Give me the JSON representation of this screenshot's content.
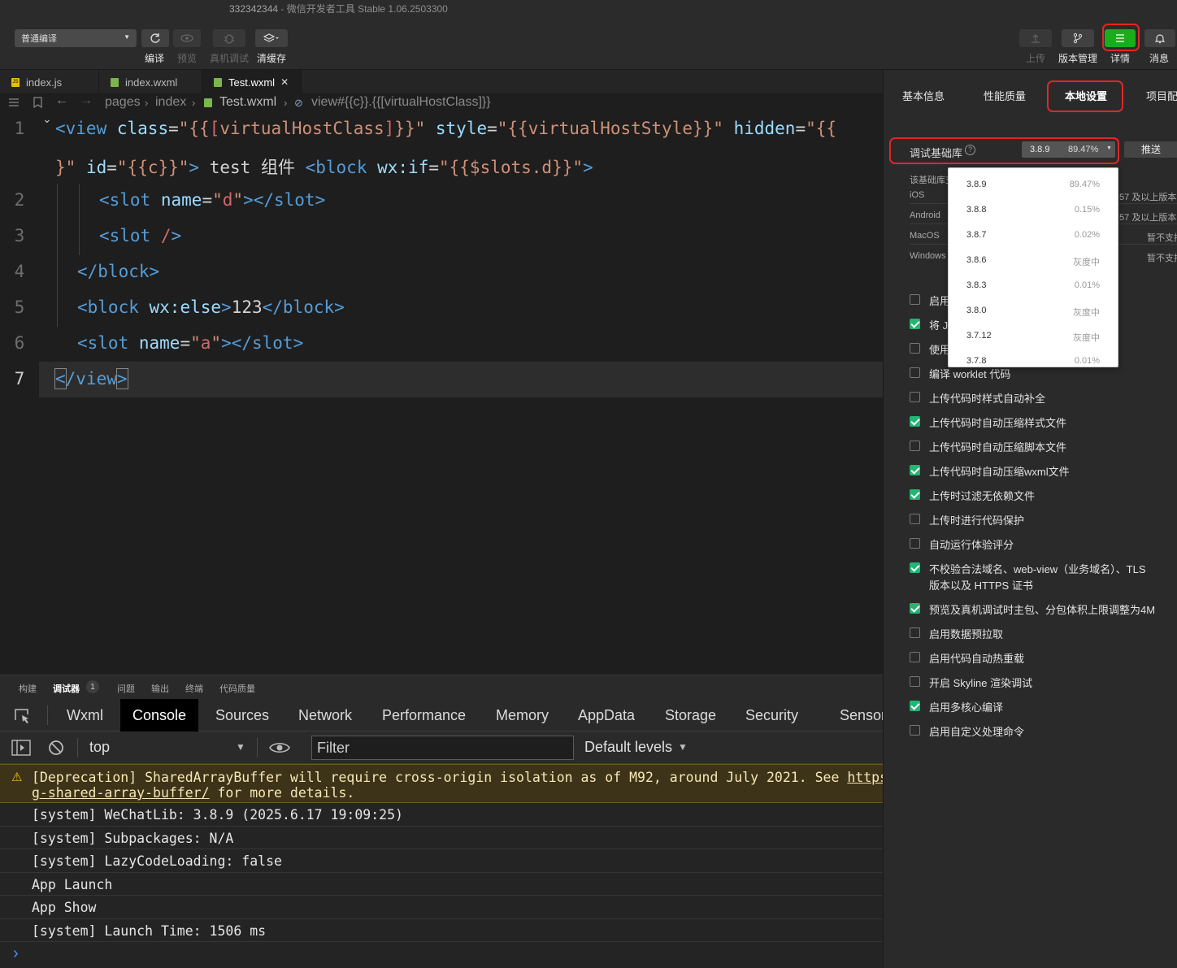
{
  "window": {
    "project_id": "332342344",
    "title_suffix": " - 微信开发者工具 Stable 1.06.2503300"
  },
  "toolbar": {
    "mode_select": "普通编译",
    "left_buttons": [
      {
        "label": "编译",
        "enabled": true
      },
      {
        "label": "预览",
        "enabled": false
      },
      {
        "label": "真机调试",
        "enabled": false
      },
      {
        "label": "清缓存",
        "enabled": true
      }
    ],
    "right_buttons": [
      {
        "label": "上传",
        "enabled": false
      },
      {
        "label": "版本管理",
        "enabled": true
      },
      {
        "label": "详情",
        "enabled": true,
        "active": true
      },
      {
        "label": "消息",
        "enabled": true
      }
    ],
    "accent_color": "#1aad19"
  },
  "file_tabs": [
    {
      "name": "index.js",
      "icon": "js-file-icon"
    },
    {
      "name": "index.wxml",
      "icon": "wxml-file-icon"
    },
    {
      "name": "Test.wxml",
      "icon": "wxml-file-icon",
      "active": true,
      "close": "✕"
    }
  ],
  "breadcrumb": {
    "path": [
      "pages",
      "index",
      "Test.wxml",
      "view#{{c}}.{{[virtualHostClass]}}"
    ]
  },
  "editor": {
    "line_numbers": [
      "1",
      "2",
      "3",
      "4",
      "5",
      "6",
      "7"
    ],
    "current_line": "7"
  },
  "bottom_panel": {
    "tabs": [
      "构建",
      "调试器",
      "问题",
      "输出",
      "终端",
      "代码质量"
    ],
    "active_tab": "调试器",
    "badge": "1"
  },
  "devtools": {
    "tabs": [
      "Wxml",
      "Console",
      "Sources",
      "Network",
      "Performance",
      "Memory",
      "AppData",
      "Storage",
      "Security",
      "Sensor"
    ],
    "active_tab": "Console",
    "context": "top",
    "filter_placeholder": "Filter",
    "levels": "Default levels"
  },
  "console": {
    "warning_line1": "[Deprecation] SharedArrayBuffer will require cross-origin isolation as of M92, around July 2021. See ",
    "warning_link": "https",
    "warning_line2_link": "g-shared-array-buffer/",
    "warning_line2_rest": " for more details.",
    "lines": [
      "[system] WeChatLib: 3.8.9 (2025.6.17 19:09:25)",
      "[system] Subpackages: N/A",
      "[system] LazyCodeLoading: false",
      "App Launch",
      "App Show",
      "[system] Launch Time: 1506 ms"
    ],
    "prompt": "›"
  },
  "right_panel": {
    "tabs": [
      "基本信息",
      "性能质量",
      "本地设置",
      "项目配"
    ],
    "active_tab": "本地设置",
    "base_lib_label": "调试基础库",
    "base_lib_version": "3.8.9",
    "base_lib_percent": "89.47%",
    "push_button": "推送",
    "info_label": "该基础库支",
    "platforms": [
      {
        "name": "iOS",
        "note": ".57 及以上版本"
      },
      {
        "name": "Android",
        "note": ".57 及以上版本"
      },
      {
        "name": "MacOS",
        "note": "暂不支持"
      },
      {
        "name": "Windows",
        "note": "暂不支持"
      }
    ],
    "checkboxes": [
      {
        "label": "启用",
        "checked": false
      },
      {
        "label": "将 JS",
        "checked": true
      },
      {
        "label": "使用",
        "checked": false
      },
      {
        "label": "编译 worklet 代码",
        "checked": false
      },
      {
        "label": "上传代码时样式自动补全",
        "checked": false
      },
      {
        "label": "上传代码时自动压缩样式文件",
        "checked": true
      },
      {
        "label": "上传代码时自动压缩脚本文件",
        "checked": false
      },
      {
        "label": "上传代码时自动压缩wxml文件",
        "checked": true
      },
      {
        "label": "上传时过滤无依赖文件",
        "checked": true
      },
      {
        "label": "上传时进行代码保护",
        "checked": false
      },
      {
        "label": "自动运行体验评分",
        "checked": false
      },
      {
        "label": "不校验合法域名、web-view（业务域名）、TLS",
        "label2": "版本以及 HTTPS 证书",
        "checked": true
      },
      {
        "label": "预览及真机调试时主包、分包体积上限调整为4M",
        "checked": true
      },
      {
        "label": "启用数据预拉取",
        "checked": false
      },
      {
        "label": "启用代码自动热重载",
        "checked": false
      },
      {
        "label": "开启 Skyline 渲染调试",
        "checked": false
      },
      {
        "label": "启用多核心编译",
        "checked": true
      },
      {
        "label": "启用自定义处理命令",
        "checked": false
      }
    ],
    "version_dropdown": [
      {
        "version": "3.8.9",
        "pct": "89.47%"
      },
      {
        "version": "3.8.8",
        "pct": "0.15%"
      },
      {
        "version": "3.8.7",
        "pct": "0.02%"
      },
      {
        "version": "3.8.6",
        "pct": "灰度中"
      },
      {
        "version": "3.8.3",
        "pct": "0.01%"
      },
      {
        "version": "3.8.0",
        "pct": "灰度中"
      },
      {
        "version": "3.7.12",
        "pct": "灰度中"
      },
      {
        "version": "3.7.8",
        "pct": "0.01%"
      }
    ]
  }
}
